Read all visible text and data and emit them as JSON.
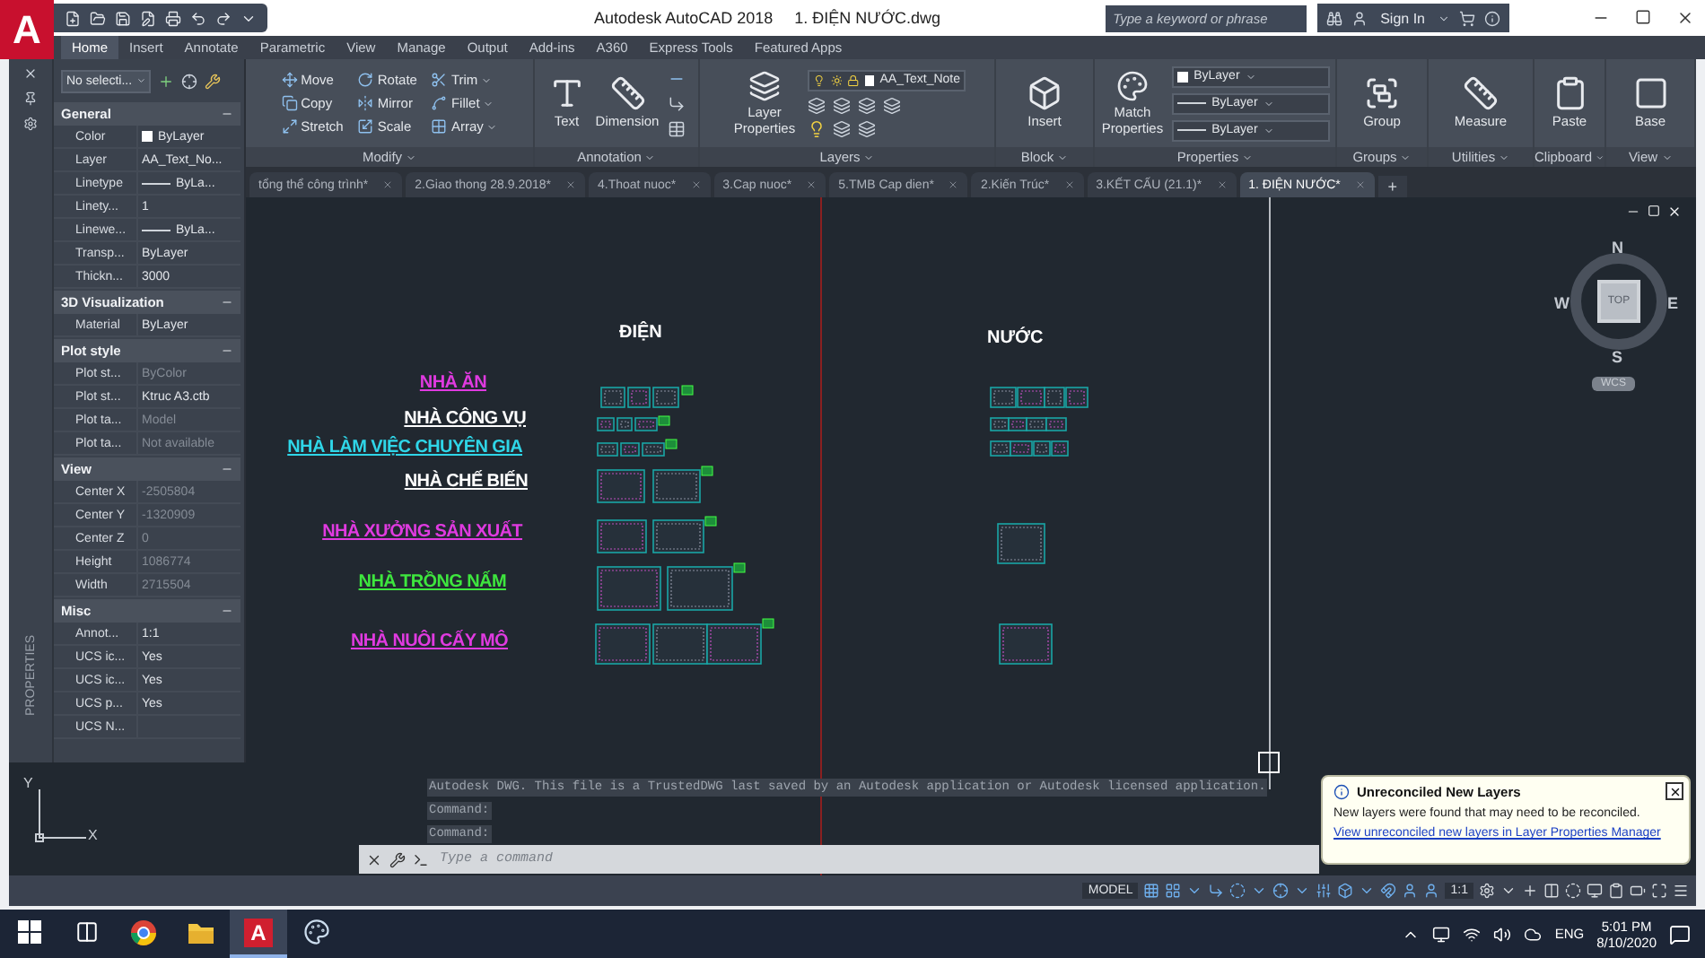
{
  "title_bar": {
    "logo": "A",
    "app": "Autodesk AutoCAD 2018",
    "file": "1. ĐIỆN NƯỚC.dwg",
    "search_placeholder": "Type a keyword or phrase",
    "sign_in": "Sign In"
  },
  "ribbon_tabs": [
    {
      "label": "Home",
      "selected": true
    },
    {
      "label": "Insert",
      "selected": false
    },
    {
      "label": "Annotate",
      "selected": false
    },
    {
      "label": "Parametric",
      "selected": false
    },
    {
      "label": "View",
      "selected": false
    },
    {
      "label": "Manage",
      "selected": false
    },
    {
      "label": "Output",
      "selected": false
    },
    {
      "label": "Add-ins",
      "selected": false
    },
    {
      "label": "A360",
      "selected": false
    },
    {
      "label": "Express Tools",
      "selected": false
    },
    {
      "label": "Featured Apps",
      "selected": false
    }
  ],
  "ribbon_panels": [
    {
      "kind": "grid",
      "title": "Modify",
      "items": [
        "Move",
        "Rotate",
        "Trim",
        "Copy",
        "Mirror",
        "Fillet",
        "Stretch",
        "Scale",
        "Array"
      ]
    },
    {
      "kind": "big",
      "title": "Annotation",
      "items": [
        "Text",
        "Dimension"
      ]
    },
    {
      "kind": "layers",
      "title": "Layers",
      "items": [
        "Layer Properties"
      ],
      "dropdown": "AA_Text_Note"
    },
    {
      "kind": "big",
      "title": "Block",
      "items": [
        "Insert"
      ]
    },
    {
      "kind": "props",
      "title": "Properties",
      "items": [
        "Match Properties"
      ],
      "dropdowns": [
        "ByLayer",
        "ByLayer",
        "ByLayer"
      ]
    },
    {
      "kind": "big",
      "title": "Groups",
      "items": [
        "Group"
      ]
    },
    {
      "kind": "big",
      "title": "Utilities",
      "items": [
        "Measure"
      ]
    },
    {
      "kind": "big",
      "title": "Clipboard",
      "items": [
        "Paste"
      ]
    },
    {
      "kind": "big",
      "title": "View",
      "items": [
        "Base"
      ]
    }
  ],
  "doc_tabs": [
    {
      "label": "tổng thể công trình*",
      "selected": false
    },
    {
      "label": "2.Giao thong 28.9.2018*",
      "selected": false
    },
    {
      "label": "4.Thoat nuoc*",
      "selected": false
    },
    {
      "label": "3.Cap nuoc*",
      "selected": false
    },
    {
      "label": "5.TMB Cap dien*",
      "selected": false
    },
    {
      "label": "2.Kiến Trúc*",
      "selected": false
    },
    {
      "label": "3.KẾT CẤU (21.1)*",
      "selected": false
    },
    {
      "label": "1. ĐIỆN NƯỚC*",
      "selected": true
    }
  ],
  "new_tab": "+",
  "palette": {
    "title": "PROPERTIES",
    "selection": "No selecti...",
    "sections": [
      {
        "title": "General",
        "rows": [
          {
            "label": "Color",
            "value": "ByLayer",
            "kind": "swatch",
            "dimmed": false
          },
          {
            "label": "Layer",
            "value": "AA_Text_No...",
            "kind": "text",
            "dimmed": false
          },
          {
            "label": "Linetype",
            "value": "ByLa...",
            "kind": "line",
            "dimmed": false
          },
          {
            "label": "Linety...",
            "value": "1",
            "kind": "text",
            "dimmed": false
          },
          {
            "label": "Linewe...",
            "value": "ByLa...",
            "kind": "line",
            "dimmed": false
          },
          {
            "label": "Transp...",
            "value": "ByLayer",
            "kind": "text",
            "dimmed": false
          },
          {
            "label": "Thickn...",
            "value": "3000",
            "kind": "text",
            "dimmed": false
          }
        ]
      },
      {
        "title": "3D Visualization",
        "rows": [
          {
            "label": "Material",
            "value": "ByLayer",
            "kind": "text",
            "dimmed": false
          }
        ]
      },
      {
        "title": "Plot style",
        "rows": [
          {
            "label": "Plot st...",
            "value": "ByColor",
            "kind": "text",
            "dimmed": true
          },
          {
            "label": "Plot st...",
            "value": "Ktruc A3.ctb",
            "kind": "text",
            "dimmed": false
          },
          {
            "label": "Plot ta...",
            "value": "Model",
            "kind": "text",
            "dimmed": true
          },
          {
            "label": "Plot ta...",
            "value": "Not available",
            "kind": "text",
            "dimmed": true
          }
        ]
      },
      {
        "title": "View",
        "rows": [
          {
            "label": "Center X",
            "value": "-2505804",
            "kind": "text",
            "dimmed": true
          },
          {
            "label": "Center Y",
            "value": "-1320909",
            "kind": "text",
            "dimmed": true
          },
          {
            "label": "Center Z",
            "value": "0",
            "kind": "text",
            "dimmed": true
          },
          {
            "label": "Height",
            "value": "1086774",
            "kind": "text",
            "dimmed": true
          },
          {
            "label": "Width",
            "value": "2715504",
            "kind": "text",
            "dimmed": true
          }
        ]
      },
      {
        "title": "Misc",
        "rows": [
          {
            "label": "Annot...",
            "value": "1:1",
            "kind": "text",
            "dimmed": false
          },
          {
            "label": "UCS ic...",
            "value": "Yes",
            "kind": "text",
            "dimmed": false
          },
          {
            "label": "UCS ic...",
            "value": "Yes",
            "kind": "text",
            "dimmed": false
          },
          {
            "label": "UCS p...",
            "value": "Yes",
            "kind": "text",
            "dimmed": false
          },
          {
            "label": "UCS N...",
            "kind": "text"
          }
        ]
      }
    ]
  },
  "drawing": {
    "headings": [
      "ĐIỆN",
      "NƯỚC"
    ],
    "labels": [
      {
        "text": "NHÀ ĂN",
        "color": "#e03ae0"
      },
      {
        "text": "NHÀ CÔNG VỤ",
        "color": "#ffffff"
      },
      {
        "text": "NHÀ LÀM VIỆC CHUYÊN GIA",
        "color": "#2fd6e8"
      },
      {
        "text": "NHÀ CHẾ BIẾN",
        "color": "#ffffff"
      },
      {
        "text": "NHÀ XƯỞNG SẢN XUẤT",
        "color": "#e03ae0"
      },
      {
        "text": "NHÀ TRỒNG NẤM",
        "color": "#3ee63e"
      },
      {
        "text": "NHÀ NUÔI CẤY MÔ",
        "color": "#e03ae0"
      }
    ],
    "viewcube": {
      "north": "N",
      "south": "S",
      "east": "E",
      "west": "W",
      "face": "TOP",
      "ucs": "WCS"
    },
    "ucs_axes": {
      "y": "Y",
      "x": "X"
    }
  },
  "command": {
    "history": [
      "Autodesk DWG.  This file is a TrustedDWG last saved by an Autodesk application or Autodesk licensed application.",
      "Command:",
      "Command:"
    ],
    "placeholder": "Type a command"
  },
  "notification": {
    "title": "Unreconciled New Layers",
    "body": "New layers were found that may need to be reconciled.",
    "link": "View unreconciled new layers in Layer Properties Manager"
  },
  "status_bar": {
    "space": "MODEL",
    "scale": "1:1"
  },
  "taskbar": {
    "apps": [
      {
        "kind": "browser",
        "selected": false
      },
      {
        "kind": "folder",
        "selected": false
      },
      {
        "kind": "cad",
        "label": "A",
        "selected": true
      },
      {
        "kind": "paint",
        "selected": false
      }
    ],
    "language": "ENG",
    "time": "5:01 PM",
    "date": "8/10/2020"
  }
}
